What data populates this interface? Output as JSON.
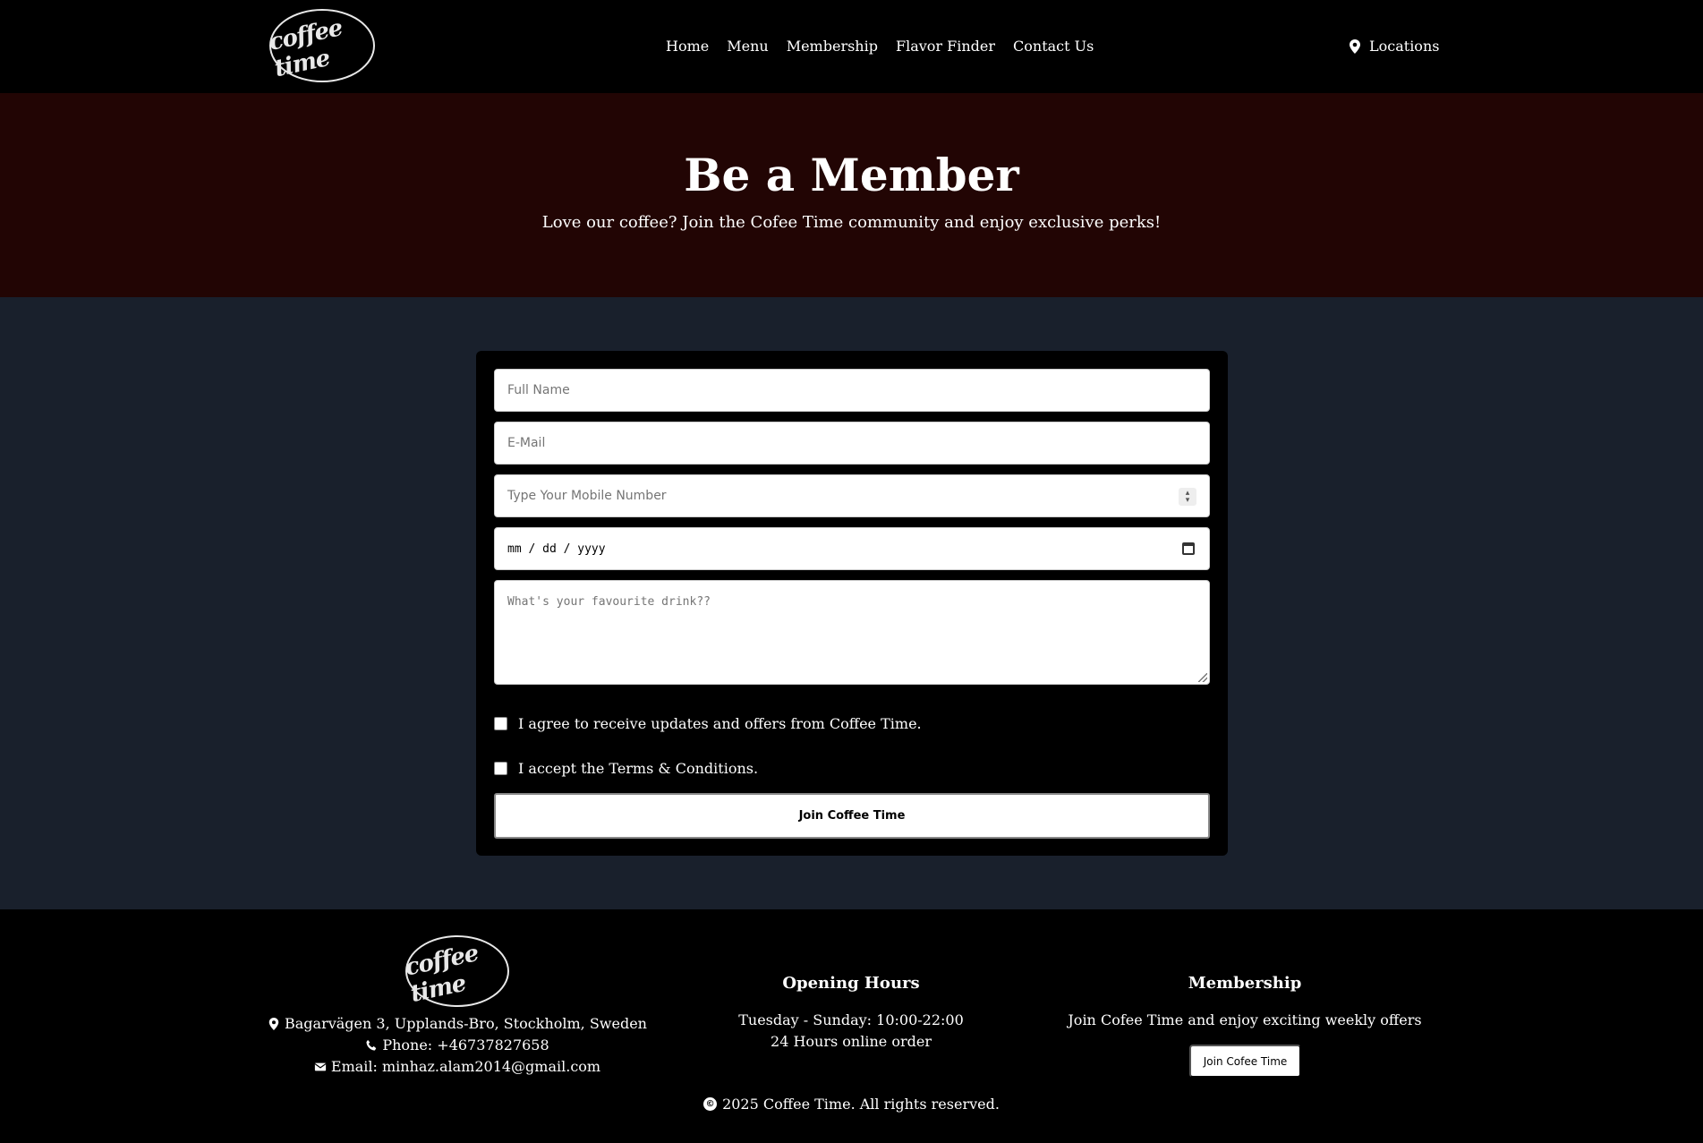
{
  "brand": {
    "logo_text": "coffee time"
  },
  "nav": {
    "items": [
      {
        "label": "Home"
      },
      {
        "label": "Menu"
      },
      {
        "label": "Membership"
      },
      {
        "label": "Flavor Finder"
      },
      {
        "label": "Contact Us"
      }
    ],
    "locations_label": "Locations",
    "locations_icon": "map-pin-icon"
  },
  "hero": {
    "title": "Be a Member",
    "subtitle": "Love our coffee? Join the Cofee Time community and enjoy exclusive perks!"
  },
  "form": {
    "full_name_placeholder": "Full Name",
    "email_placeholder": "E-Mail",
    "mobile_placeholder": "Type Your Mobile Number",
    "date_placeholder": "mm / dd / yyyy",
    "drink_placeholder": "What's your favourite drink??",
    "agree_updates_label": "I agree to receive updates and offers from Coffee Time.",
    "accept_terms_label": "I accept the Terms & Conditions.",
    "submit_label": "Join Coffee Time"
  },
  "footer": {
    "logo_text": "coffee time",
    "address": "Bagarvägen 3, Upplands-Bro, Stockholm, Sweden",
    "phone": "Phone: +46737827658",
    "email": "Email: minhaz.alam2014@gmail.com",
    "hours_title": "Opening Hours",
    "hours_line1": "Tuesday - Sunday: 10:00-22:00",
    "hours_line2": "24 Hours online order",
    "membership_title": "Membership",
    "membership_text": "Join Cofee Time and enjoy exciting weekly offers",
    "membership_button": "Join Cofee Time",
    "copyright": "2025 Coffee Time. All rights reserved."
  },
  "colors": {
    "navbar_bg": "#000000",
    "hero_bg": "#220504",
    "page_bg": "#19202c",
    "card_bg": "#000000"
  }
}
